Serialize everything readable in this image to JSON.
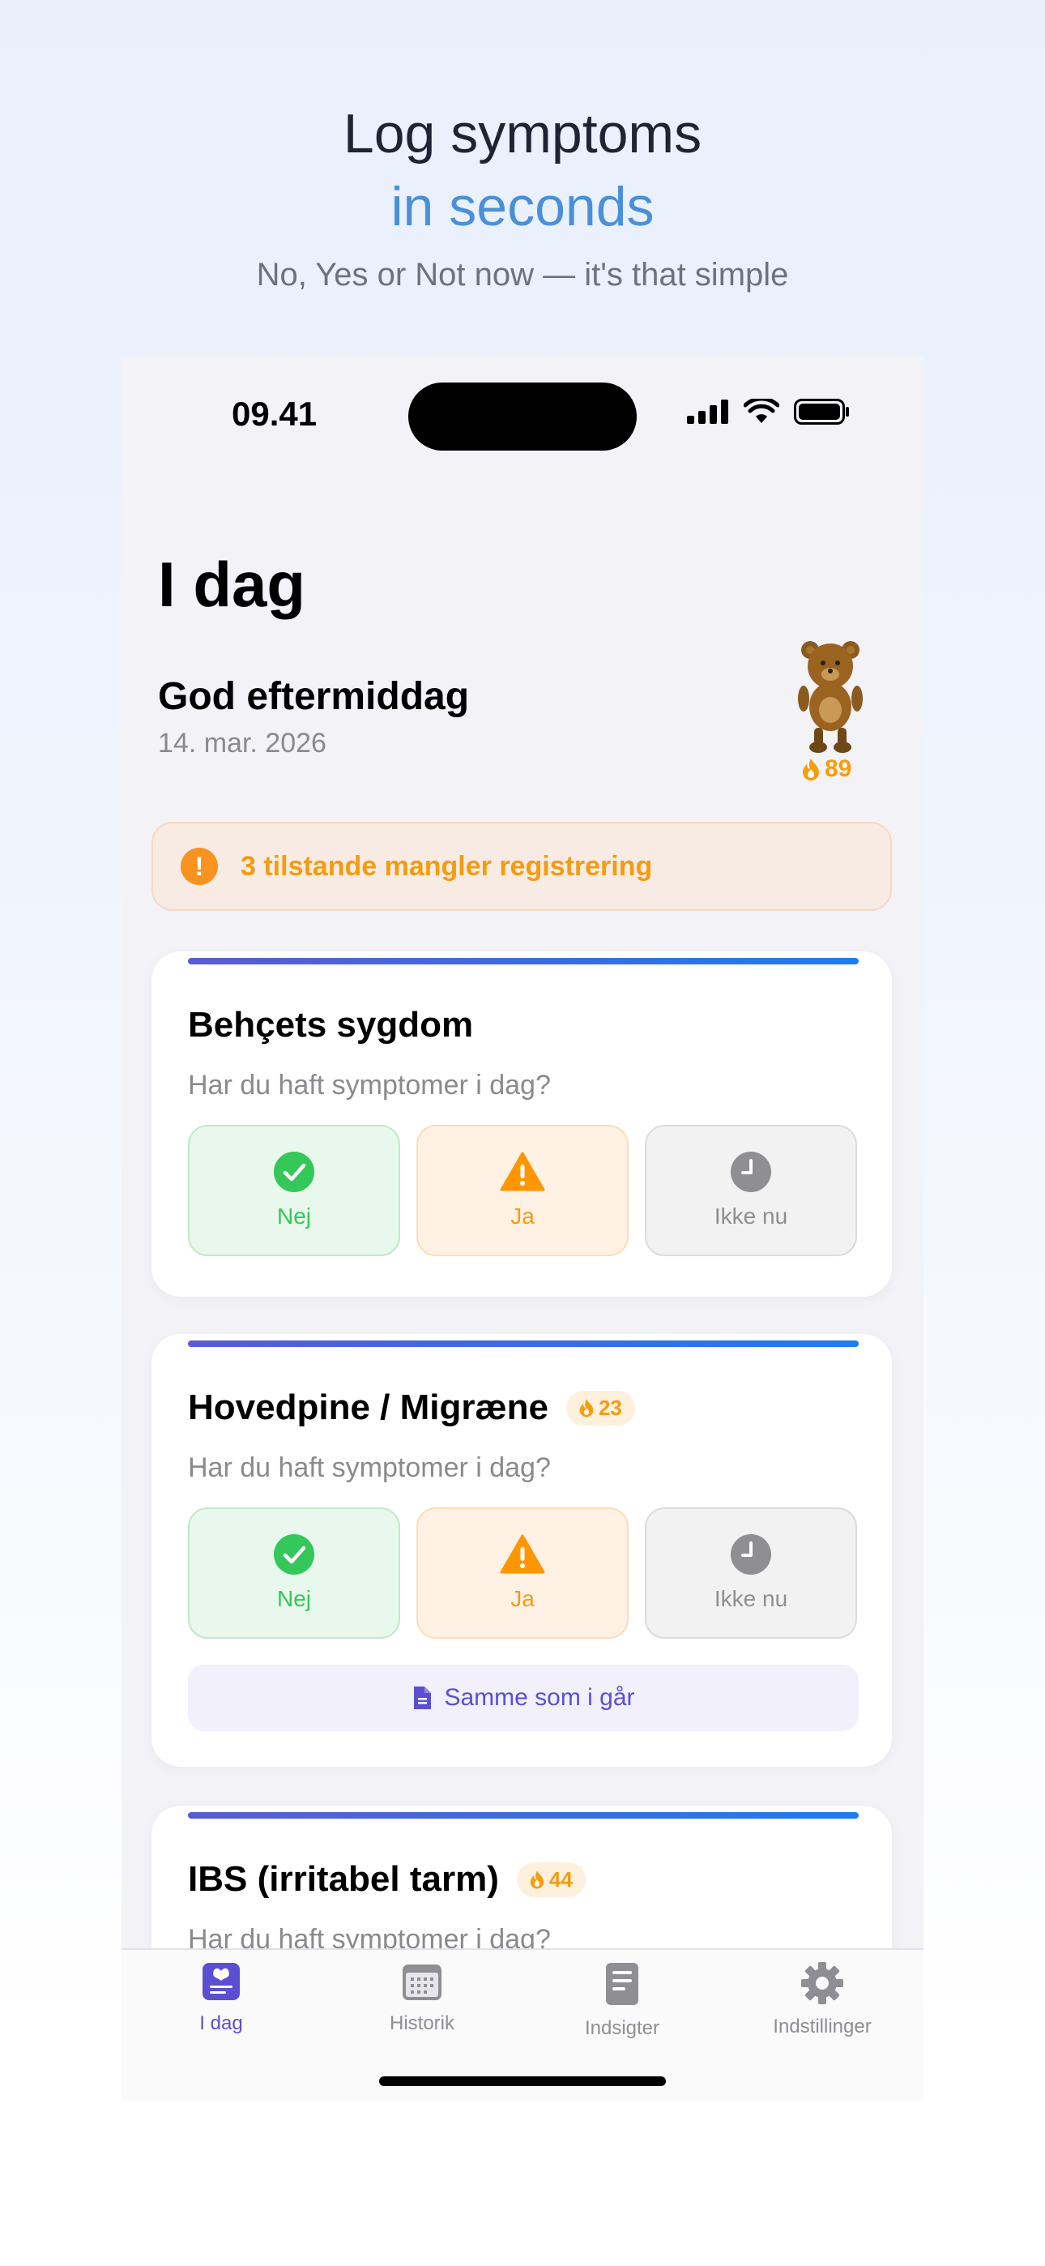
{
  "hero": {
    "line1": "Log symptoms",
    "line2": "in seconds",
    "subtitle": "No, Yes or Not now — it's that simple"
  },
  "status_bar": {
    "time": "09.41"
  },
  "header": {
    "title": "I dag",
    "greeting": "God eftermiddag",
    "date": "14. mar. 2026",
    "streak": "89"
  },
  "alert": {
    "text": "3 tilstande mangler registrering"
  },
  "cards": [
    {
      "title": "Behçets sygdom",
      "question": "Har du haft symptomer i dag?",
      "choices": {
        "no": "Nej",
        "yes": "Ja",
        "later": "Ikke nu"
      }
    },
    {
      "title": "Hovedpine / Migræne",
      "streak": "23",
      "question": "Har du haft symptomer i dag?",
      "choices": {
        "no": "Nej",
        "yes": "Ja",
        "later": "Ikke nu"
      },
      "same_as_yesterday": "Samme som i går"
    },
    {
      "title": "IBS (irritabel tarm)",
      "streak": "44",
      "question": "Har du haft symptomer i dag?"
    }
  ],
  "tabbar": {
    "items": [
      {
        "label": "I dag",
        "icon": "heart-note-icon",
        "active": true
      },
      {
        "label": "Historik",
        "icon": "calendar-icon",
        "active": false
      },
      {
        "label": "Indsigter",
        "icon": "document-icon",
        "active": false
      },
      {
        "label": "Indstillinger",
        "icon": "gear-icon",
        "active": false
      }
    ]
  },
  "colors": {
    "accent": "#5B4FD1",
    "hero_blue": "#4A90D9",
    "warning": "#F39C12",
    "success": "#34C759",
    "neutral": "#8E8E93"
  }
}
